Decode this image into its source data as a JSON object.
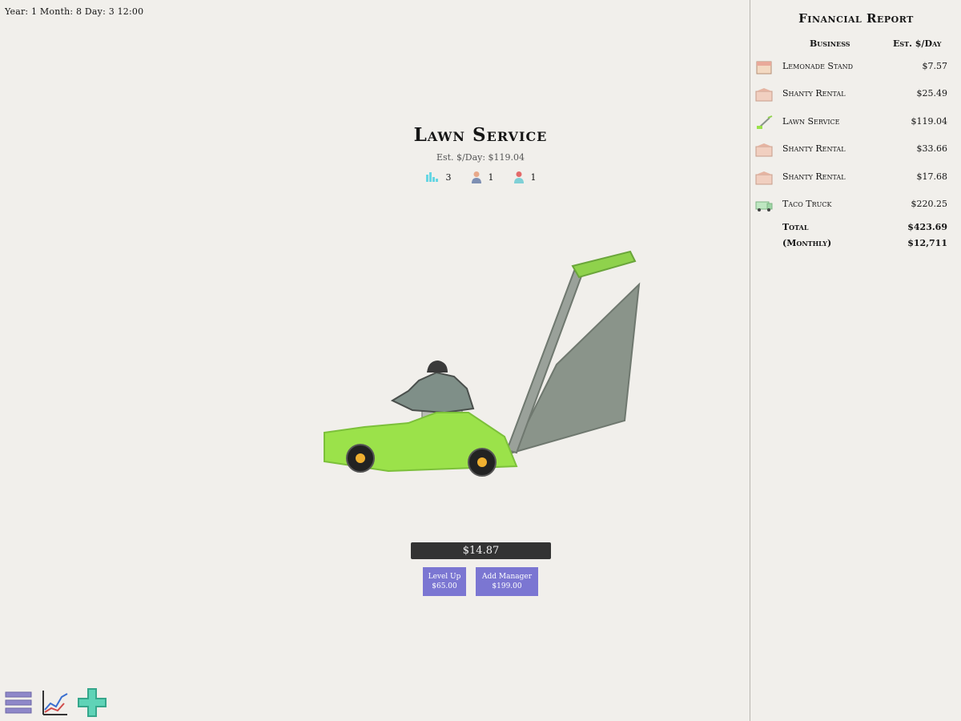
{
  "hud": {
    "clock": "Year: 1 Month: 8 Day: 3 12:00"
  },
  "business": {
    "title": "Lawn Service",
    "est_per_day": "Est. $/Day: $119.04",
    "stats": {
      "level": "3",
      "managers": "1",
      "workers": "1"
    },
    "cash": "$14.87",
    "level_up": {
      "label": "Level Up",
      "price": "$65.00"
    },
    "add_manager": {
      "label": "Add Manager",
      "price": "$199.00"
    }
  },
  "report": {
    "title": "Financial Report",
    "col_business": "Business",
    "col_est": "Est. $/Day",
    "rows": [
      {
        "icon": "lemonade-stand-icon",
        "name": "Lemonade Stand",
        "amount": "$7.57"
      },
      {
        "icon": "shanty-icon",
        "name": "Shanty Rental",
        "amount": "$25.49"
      },
      {
        "icon": "lawn-mower-icon",
        "name": "Lawn Service",
        "amount": "$119.04"
      },
      {
        "icon": "shanty-icon",
        "name": "Shanty Rental",
        "amount": "$33.66"
      },
      {
        "icon": "shanty-icon",
        "name": "Shanty Rental",
        "amount": "$17.68"
      },
      {
        "icon": "taco-truck-icon",
        "name": "Taco Truck",
        "amount": "$220.25"
      }
    ],
    "total_label": "Total",
    "total_amount": "$423.69",
    "monthly_label": "(Monthly)",
    "monthly_amount": "$12,711"
  },
  "toolbar": {
    "items": [
      "menu-icon",
      "chart-icon",
      "add-icon"
    ]
  },
  "colors": {
    "button": "#7b76d2",
    "cash_bar": "#333333",
    "mower_body": "#9be24a",
    "mower_bag": "#8a948a"
  }
}
